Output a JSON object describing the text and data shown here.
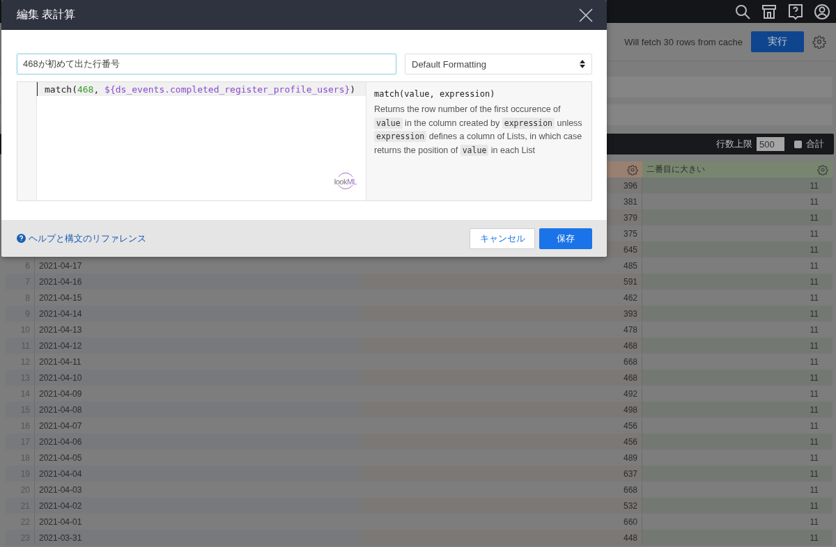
{
  "toolbar": {
    "cache_note": "Will fetch 30 rows from cache",
    "run_button": "実行"
  },
  "results_bar": {
    "row_limit_label": "行数上限",
    "row_limit": "500",
    "totals": {
      "label": "合計",
      "checked": false
    }
  },
  "table": {
    "last_column_label": "二番目に大きい",
    "rows": [
      {
        "column_3": "396",
        "second_largest": "11"
      },
      {
        "column_3": "381",
        "second_largest": "11"
      },
      {
        "column_3": "379",
        "second_largest": "11"
      },
      {
        "column_3": "375",
        "second_largest": "11"
      },
      {
        "column_3": "645",
        "second_largest": "11"
      },
      {
        "row": "6",
        "date": "2021-04-17",
        "column_3": "485",
        "second_largest": "11"
      },
      {
        "row": "7",
        "date": "2021-04-16",
        "column_3": "591",
        "second_largest": "11"
      },
      {
        "row": "8",
        "date": "2021-04-15",
        "column_3": "462",
        "second_largest": "11"
      },
      {
        "row": "9",
        "date": "2021-04-14",
        "column_3": "393",
        "second_largest": "11"
      },
      {
        "row": "10",
        "date": "2021-04-13",
        "column_3": "478",
        "second_largest": "11"
      },
      {
        "row": "11",
        "date": "2021-04-12",
        "column_3": "468",
        "second_largest": "11"
      },
      {
        "row": "12",
        "date": "2021-04-11",
        "column_3": "668",
        "second_largest": "11"
      },
      {
        "row": "13",
        "date": "2021-04-10",
        "column_3": "468",
        "second_largest": "11"
      },
      {
        "row": "14",
        "date": "2021-04-09",
        "column_3": "492",
        "second_largest": "11"
      },
      {
        "row": "15",
        "date": "2021-04-08",
        "column_3": "498",
        "second_largest": "11"
      },
      {
        "row": "16",
        "date": "2021-04-07",
        "column_3": "456",
        "second_largest": "11"
      },
      {
        "row": "17",
        "date": "2021-04-06",
        "column_3": "456",
        "second_largest": "11"
      },
      {
        "row": "18",
        "date": "2021-04-05",
        "column_3": "489",
        "second_largest": "11"
      },
      {
        "row": "19",
        "date": "2021-04-04",
        "column_3": "637",
        "second_largest": "11"
      },
      {
        "row": "20",
        "date": "2021-04-03",
        "column_3": "668",
        "second_largest": "11"
      },
      {
        "row": "21",
        "date": "2021-04-02",
        "column_3": "532",
        "second_largest": "11"
      },
      {
        "row": "22",
        "date": "2021-04-01",
        "column_3": "660",
        "second_largest": "11"
      },
      {
        "row": "23",
        "date": "2021-03-31",
        "column_3": "448",
        "second_largest": "11"
      }
    ]
  },
  "dialog": {
    "title": "編集 表計算",
    "name_field": {
      "value": "468が初めて出た行番号"
    },
    "format_select": {
      "value": "Default Formatting"
    },
    "editor": {
      "tokens": [
        {
          "kind": "plain",
          "text": "match("
        },
        {
          "kind": "number",
          "text": "468"
        },
        {
          "kind": "plain",
          "text": ", "
        },
        {
          "kind": "field",
          "text": "${ds_events.completed_register_profile_users}"
        },
        {
          "kind": "plain",
          "text": ")"
        }
      ],
      "logo": [
        "look",
        "ML"
      ]
    },
    "help": {
      "signature": "match(value, expression)",
      "description": [
        {
          "kind": "text",
          "text": "Returns the row number of the first occurence of "
        },
        {
          "kind": "code",
          "text": "value"
        },
        {
          "kind": "text",
          "text": " in the column created by "
        },
        {
          "kind": "code",
          "text": "expression"
        },
        {
          "kind": "text",
          "text": " unless "
        },
        {
          "kind": "code",
          "text": "expression"
        },
        {
          "kind": "text",
          "text": " defines a column of Lists, in which case returns the position of "
        },
        {
          "kind": "code",
          "text": "value"
        },
        {
          "kind": "text",
          "text": " in each List"
        }
      ]
    },
    "help_link": "ヘルプと構文のリファレンス",
    "buttons": [
      {
        "kind": "secondary",
        "label": "キャンセル"
      },
      {
        "kind": "primary",
        "label": "保存"
      }
    ]
  }
}
